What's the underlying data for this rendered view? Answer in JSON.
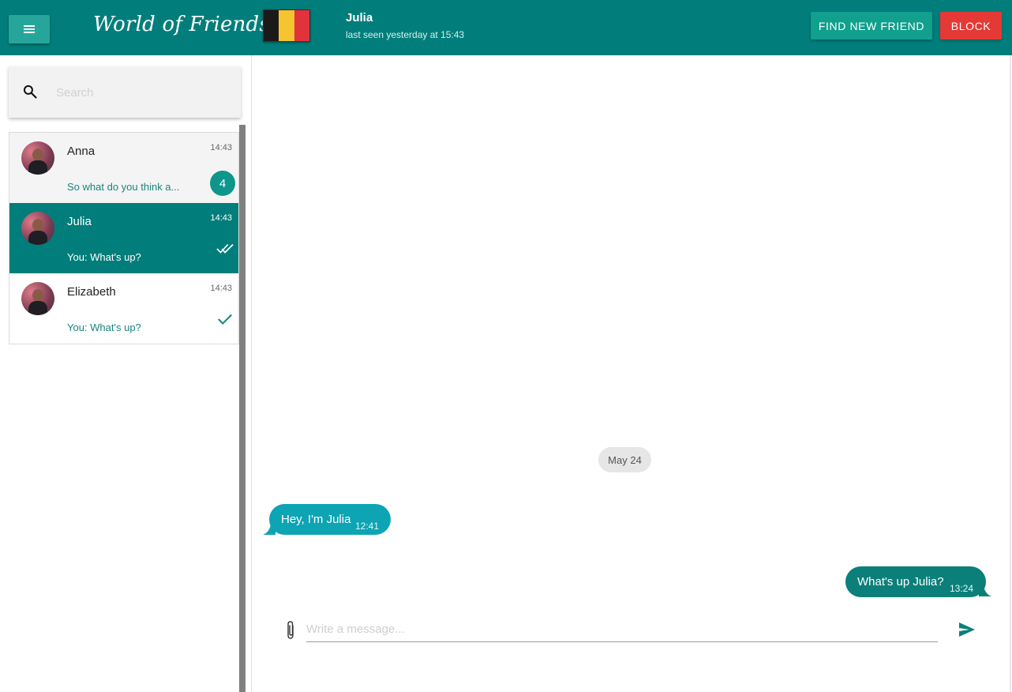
{
  "header": {
    "menu_icon": "hamburger-menu-icon",
    "app_title": "World of Friends",
    "flag_colors": [
      "#1a1a1a",
      "#f4c530",
      "#e2323b"
    ],
    "contact_name": "Julia",
    "contact_status": "last seen yesterday at 15:43",
    "find_button_label": "FIND NEW FRIEND",
    "block_button_label": "BLOCK"
  },
  "sidebar": {
    "search": {
      "icon": "search-icon",
      "placeholder": "Search",
      "value": ""
    },
    "conversations": [
      {
        "name": "Anna",
        "time": "14:43",
        "preview": "So what do you think a...",
        "unread_count": "4",
        "state": "unread"
      },
      {
        "name": "Julia",
        "time": "14:43",
        "preview": "You: What's up?",
        "status_icon": "double-check-icon",
        "state": "active"
      },
      {
        "name": "Elizabeth",
        "time": "14:43",
        "preview": "You: What's up?",
        "status_icon": "check-icon",
        "state": "read"
      }
    ]
  },
  "chat": {
    "date_chip": "May 24",
    "messages": [
      {
        "direction": "incoming",
        "text": "Hey, I'm Julia",
        "time": "12:41"
      },
      {
        "direction": "outgoing",
        "text": "What's up Julia?",
        "time": "13:24"
      }
    ],
    "composer": {
      "attach_icon": "paperclip-icon",
      "placeholder": "Write a message...",
      "value": "",
      "send_icon": "send-icon"
    }
  },
  "colors": {
    "primary": "#017e7b",
    "accent": "#26a69a",
    "danger": "#e53935",
    "incoming_bubble": "#0da4b4",
    "outgoing_bubble": "#0b7f7a"
  }
}
